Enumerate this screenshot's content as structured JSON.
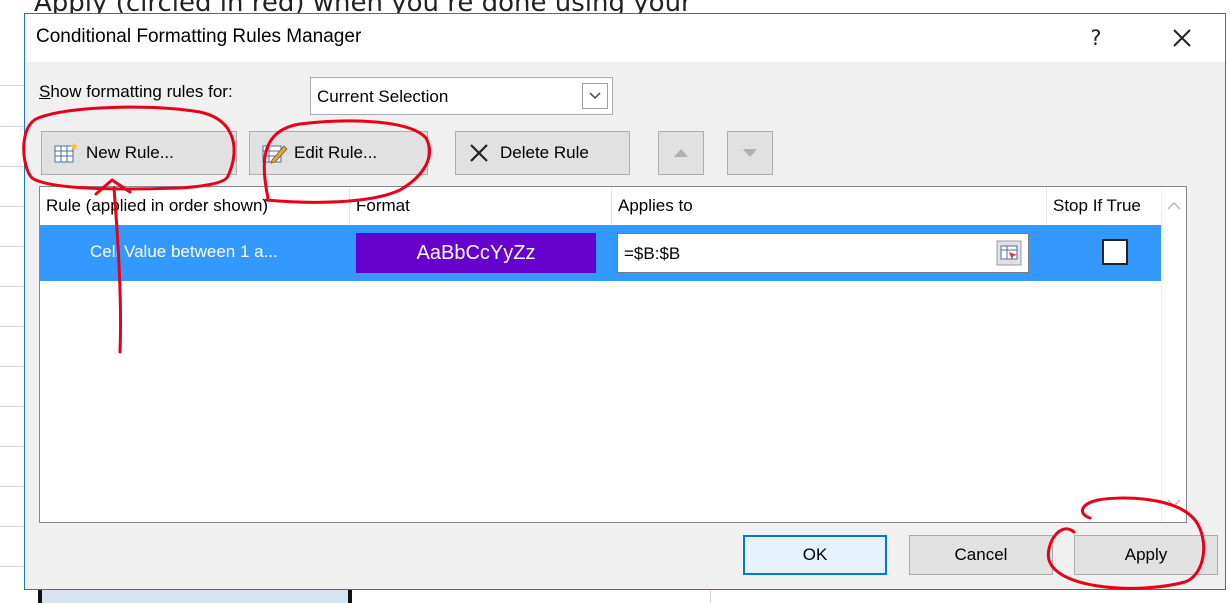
{
  "background": {
    "top_text": "Apply (circled in red) when you’re done using your"
  },
  "dialog": {
    "title": "Conditional Formatting Rules Manager",
    "help_label": "?",
    "close_label": "✕",
    "show_rules_label_prefix": "S",
    "show_rules_label_rest": "how formatting rules for:",
    "show_rules_value": "Current Selection",
    "toolbar": {
      "new_rule": "New Rule...",
      "edit_rule": "Edit Rule...",
      "delete_rule": "Delete Rule"
    },
    "columns": {
      "rule": "Rule (applied in order shown)",
      "format": "Format",
      "applies_to": "Applies to",
      "stop_if_true": "Stop If True"
    },
    "rules": [
      {
        "rule": "Cell Value between 1 a...",
        "format_preview": "AaBbCcYyZz",
        "applies_to": "=$B:$B",
        "stop_if_true": false
      }
    ],
    "buttons": {
      "ok": "OK",
      "cancel": "Cancel",
      "apply": "Apply"
    },
    "colors": {
      "selection": "#3399ff",
      "format_fill": "#6600cc",
      "annotation": "#e8001a"
    }
  }
}
